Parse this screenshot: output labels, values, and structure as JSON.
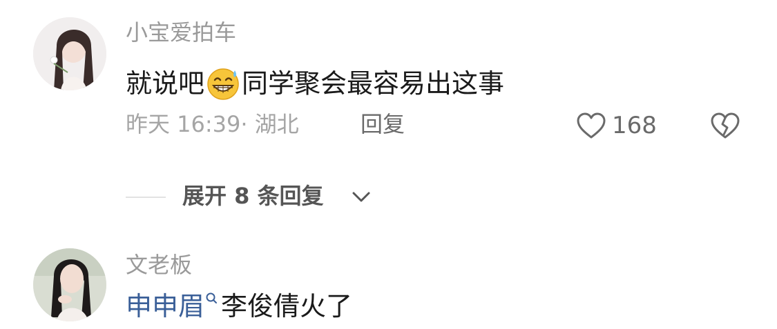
{
  "comments": [
    {
      "username": "小宝爱拍车",
      "text_before": "就说吧",
      "emoji": "grinning-sweat-emoji",
      "text_after": "同学聚会最容易出这事",
      "time_location": "昨天 16:39· 湖北",
      "reply_label": "回复",
      "like_count": "168",
      "expand_replies_label": "展开 8 条回复"
    },
    {
      "username": "文老板",
      "mention": "申申眉",
      "text": "李俊倩火了"
    }
  ],
  "icons": {
    "like": "heart-outline-icon",
    "dislike": "broken-heart-icon",
    "expand": "chevron-down-icon",
    "mention": "search-icon"
  },
  "colors": {
    "username": "#9a9a9a",
    "body_text": "#1a1a1a",
    "meta": "#a5a5a5",
    "mention": "#3a5f98",
    "icon": "#6a6a6a"
  }
}
